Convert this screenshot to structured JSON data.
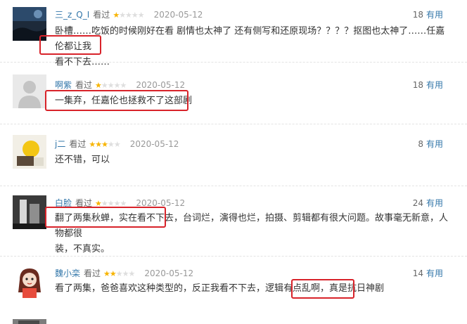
{
  "reviews": [
    {
      "user": "三_z_Q_I",
      "action": "看过",
      "stars": 1,
      "date": "2020-05-12",
      "votes": "18",
      "useful_label": "有用",
      "line1": "卧槽……吃饭的时候刚好在看 剧情也太神了 还有侧写和还原现场？？？？抠图也太神了……任嘉伦都让我",
      "line2": "看不下去……"
    },
    {
      "user": "啊紫",
      "action": "看过",
      "stars": 1,
      "date": "2020-05-12",
      "votes": "18",
      "useful_label": "有用",
      "line1": "一集弃，任嘉伦也拯救不了这部剧"
    },
    {
      "user": "j二",
      "action": "看过",
      "stars": 3,
      "date": "2020-05-12",
      "votes": "8",
      "useful_label": "有用",
      "line1": "还不错，可以"
    },
    {
      "user": "白脸",
      "action": "看过",
      "stars": 1,
      "date": "2020-05-12",
      "votes": "24",
      "useful_label": "有用",
      "line1": "翻了两集秋蝉，实在看不下去，台词烂，演得也烂，拍摄、剪辑都有很大问题。故事毫无新意，人物都很",
      "line2": "装，不真实。"
    },
    {
      "user": "魏小栾",
      "action": "看过",
      "stars": 2,
      "date": "2020-05-12",
      "votes": "14",
      "useful_label": "有用",
      "line1": "看了两集，爸爸喜欢这种类型的，反正我看不下去，逻辑有点乱啊，真是抗日神剧"
    }
  ],
  "colors": {
    "link": "#3377aa",
    "star_on": "#f7b400",
    "star_off": "#dedede",
    "highlight_box": "#d8232a"
  }
}
